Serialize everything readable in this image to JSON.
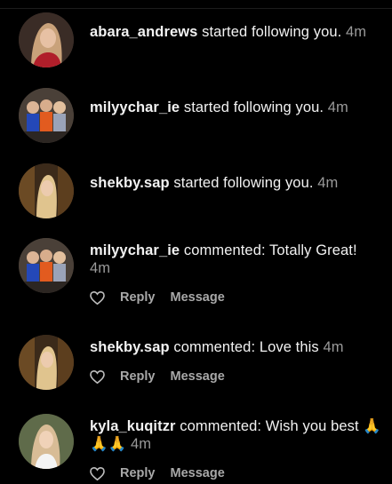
{
  "notifications": [
    {
      "username": "abara_andrews",
      "message": "started following you.",
      "time": "4m"
    },
    {
      "username": "milyychar_ie",
      "message": "started following you.",
      "time": "4m"
    },
    {
      "username": "shekby.sap",
      "message": "started following you.",
      "time": "4m"
    },
    {
      "username": "milyychar_ie",
      "message": "commented: Totally Great!",
      "time": "4m",
      "actions": {
        "reply": "Reply",
        "message": "Message"
      }
    },
    {
      "username": "shekby.sap",
      "message": "commented: Love this",
      "time": "4m",
      "actions": {
        "reply": "Reply",
        "message": "Message"
      }
    },
    {
      "username": "kyla_kuqitzr",
      "message": "commented: Wish you best 🙏🙏🙏",
      "time": "4m",
      "actions": {
        "reply": "Reply",
        "message": "Message"
      }
    }
  ]
}
